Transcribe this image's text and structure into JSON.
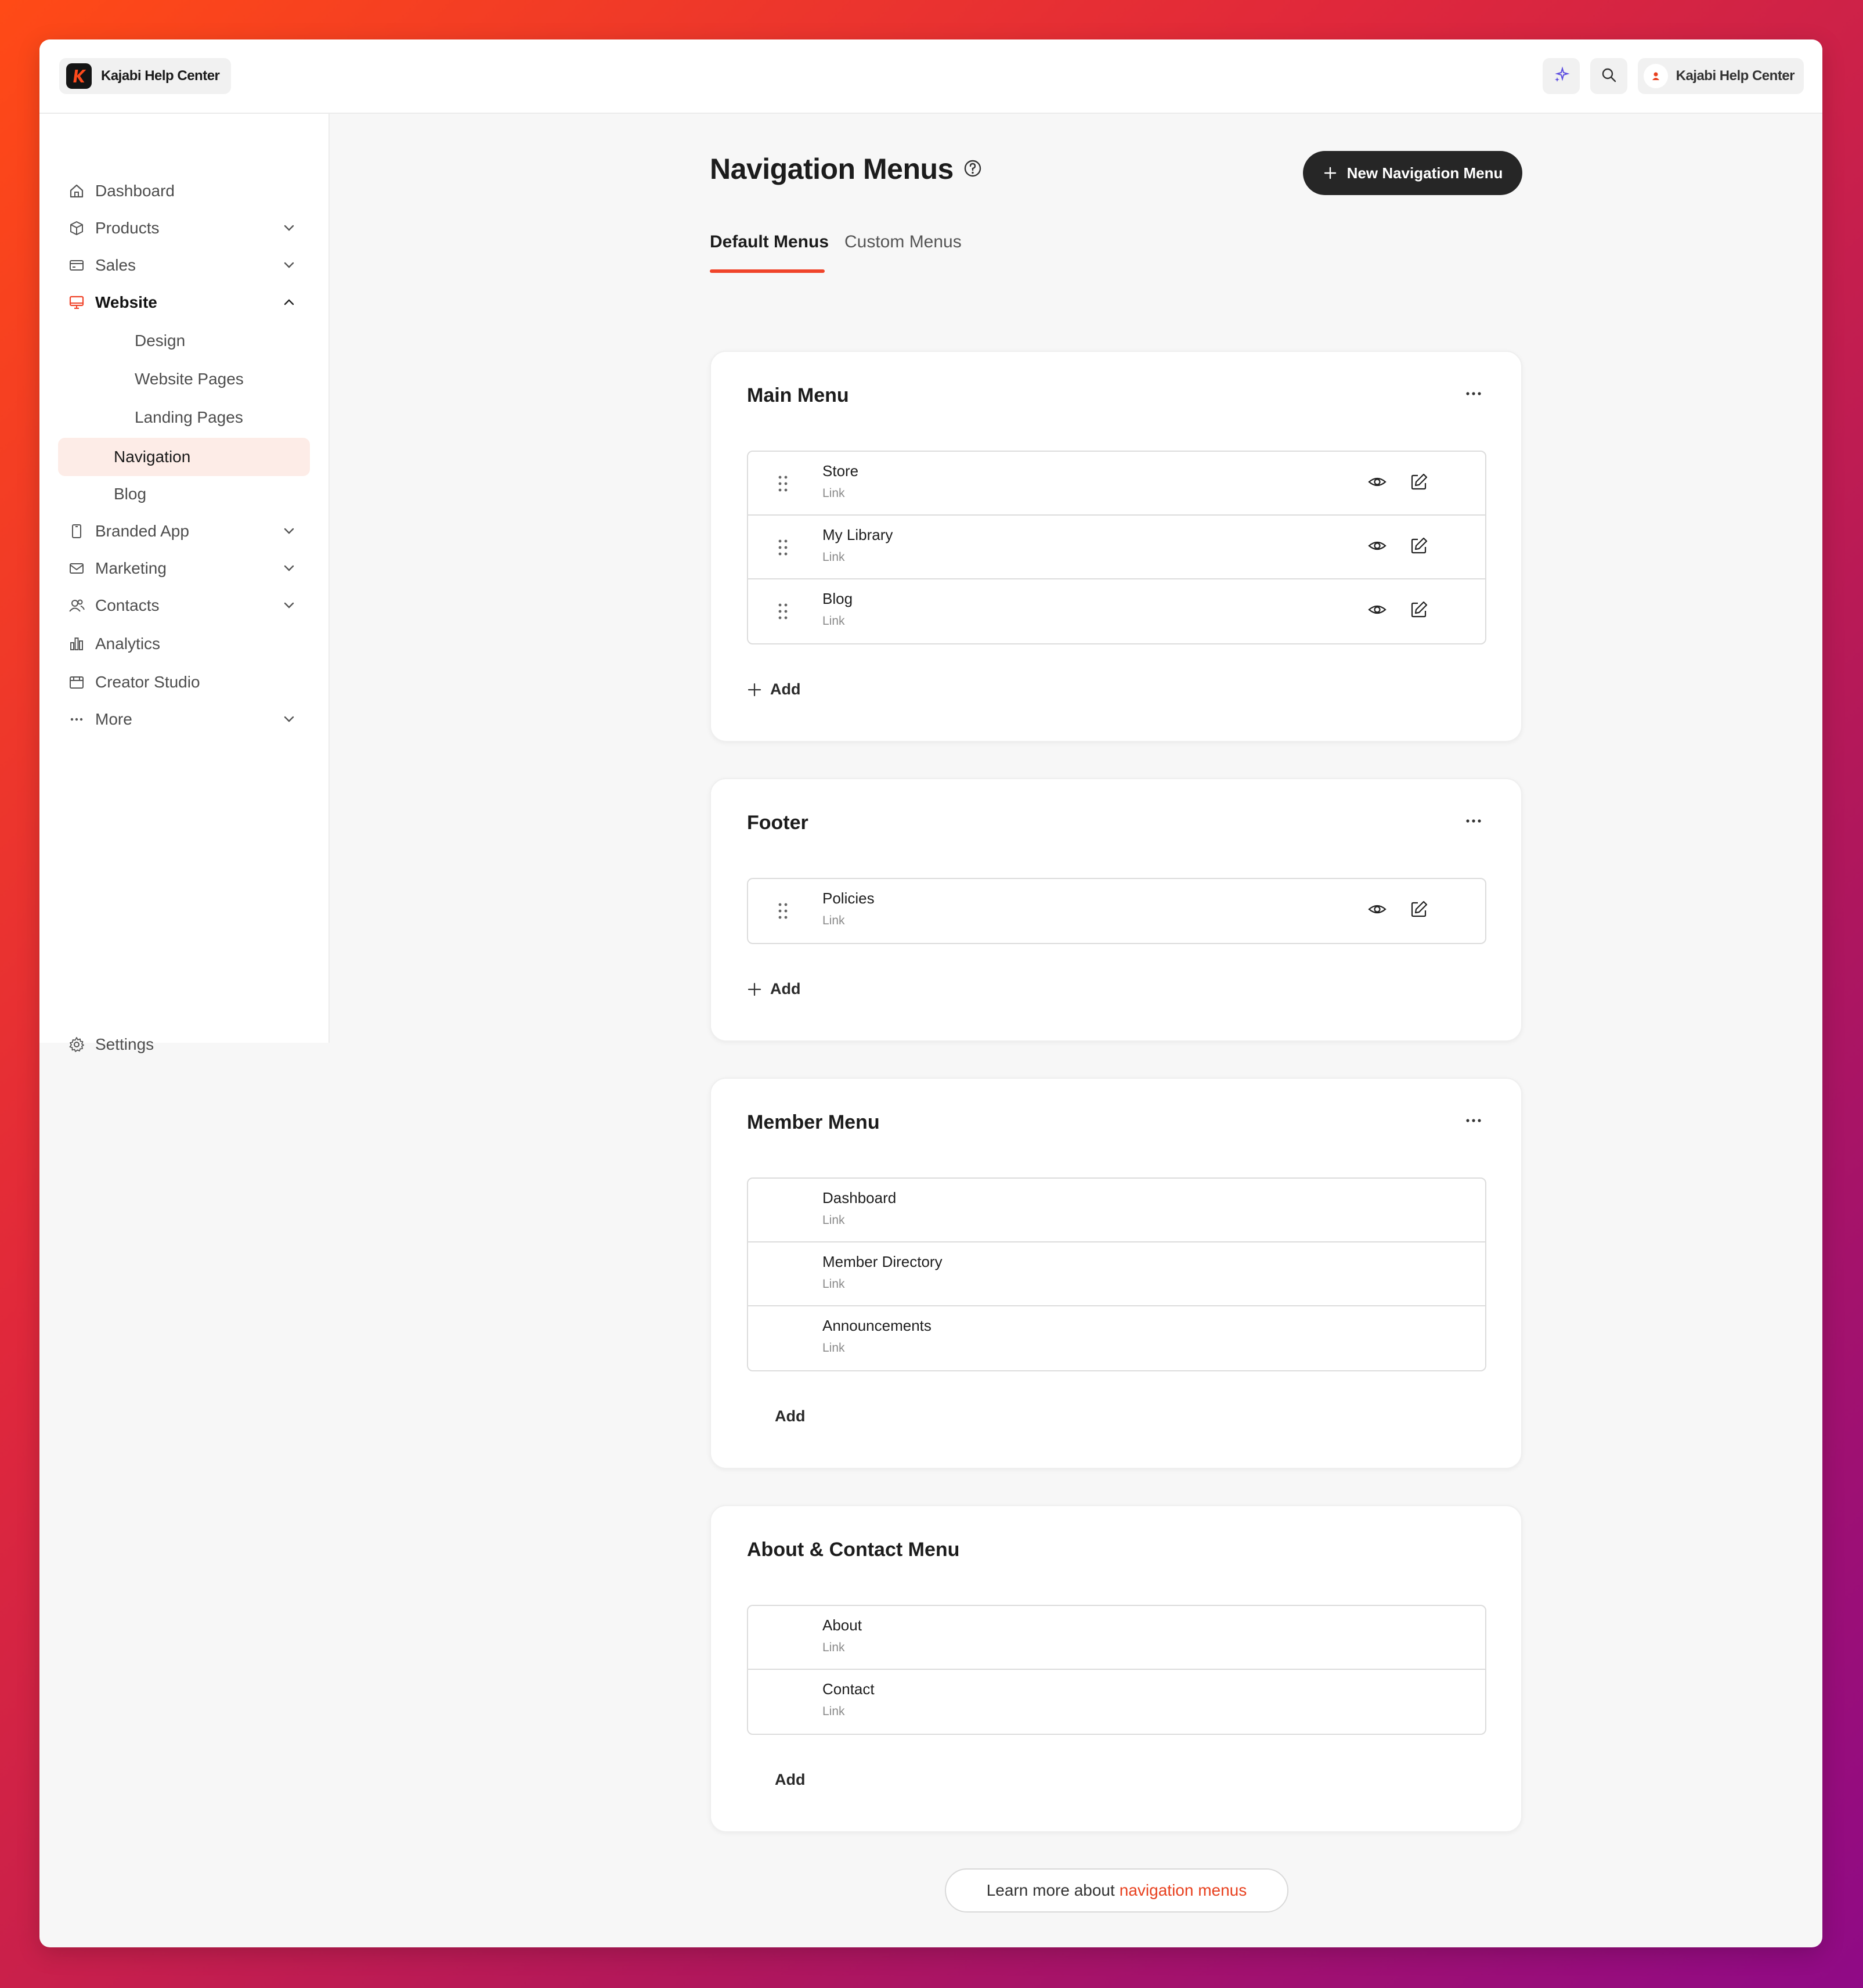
{
  "brand": {
    "name": "Kajabi Help Center"
  },
  "account": {
    "name": "Kajabi Help Center"
  },
  "top_icons": [
    "sparkle-icon",
    "search-icon"
  ],
  "sidebar": {
    "items": [
      {
        "label": "Dashboard",
        "icon": "home-icon"
      },
      {
        "label": "Products",
        "icon": "box-icon",
        "expandable": true
      },
      {
        "label": "Sales",
        "icon": "credit-card-icon",
        "expandable": true
      },
      {
        "label": "Website",
        "icon": "monitor-icon",
        "expanded": true
      },
      {
        "label": "Design"
      },
      {
        "label": "Website Pages"
      },
      {
        "label": "Landing Pages"
      },
      {
        "label": "Navigation",
        "selected": true
      },
      {
        "label": "Blog"
      },
      {
        "label": "Branded App",
        "icon": "phone-icon",
        "expandable": true
      },
      {
        "label": "Marketing",
        "icon": "mail-icon",
        "expandable": true
      },
      {
        "label": "Contacts",
        "icon": "users-icon",
        "expandable": true
      },
      {
        "label": "Analytics",
        "icon": "bar-chart-icon"
      },
      {
        "label": "Creator Studio",
        "icon": "calendar-icon"
      },
      {
        "label": "More",
        "icon": "more-icon",
        "expandable": true
      }
    ],
    "settings": {
      "label": "Settings",
      "icon": "gear-icon"
    }
  },
  "page": {
    "title": "Navigation Menus",
    "new_button": "New Navigation Menu",
    "tabs": [
      {
        "label": "Default Menus",
        "active": true
      },
      {
        "label": "Custom Menus",
        "active": false
      }
    ]
  },
  "menus": [
    {
      "title": "Main Menu",
      "items": [
        {
          "name": "Store",
          "type": "Link"
        },
        {
          "name": "My Library",
          "type": "Link"
        },
        {
          "name": "Blog",
          "type": "Link"
        }
      ],
      "add_label": "Add"
    },
    {
      "title": "Footer",
      "items": [
        {
          "name": "Policies",
          "type": "Link"
        }
      ],
      "add_label": "Add"
    },
    {
      "title": "Member Menu",
      "items": [
        {
          "name": "Dashboard",
          "type": "Link"
        },
        {
          "name": "Member Directory",
          "type": "Link"
        },
        {
          "name": "Announcements",
          "type": "Link"
        }
      ],
      "add_label": "Add"
    },
    {
      "title": "About & Contact Menu",
      "items": [
        {
          "name": "About",
          "type": "Link"
        },
        {
          "name": "Contact",
          "type": "Link"
        }
      ],
      "add_label": "Add"
    }
  ],
  "learn_more": {
    "text": "Learn more about",
    "link": "navigation menus"
  },
  "colors": {
    "accent": "#f0442a",
    "dark": "#262626",
    "selected_bg": "#fdece7",
    "sparkle": "#5b4ce0"
  }
}
